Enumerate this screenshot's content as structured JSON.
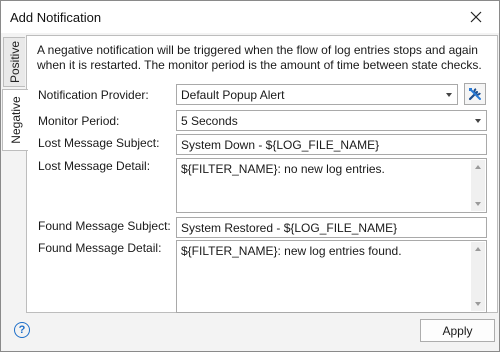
{
  "window": {
    "title": "Add Notification"
  },
  "tabs": [
    {
      "label": "Positive",
      "active": false
    },
    {
      "label": "Negative",
      "active": true
    }
  ],
  "description": "A negative notification will be triggered when the flow of log entries stops and again when it is restarted.  The monitor period is the amount of time between state checks.",
  "form": {
    "provider": {
      "label": "Notification Provider:",
      "value": "Default Popup Alert"
    },
    "monitor_period": {
      "label": "Monitor Period:",
      "value": "5 Seconds"
    },
    "lost_subject": {
      "label": "Lost Message Subject:",
      "value": "System Down - ${LOG_FILE_NAME}"
    },
    "lost_detail": {
      "label": "Lost Message Detail:",
      "value": "${FILTER_NAME}: no new log entries."
    },
    "found_subject": {
      "label": "Found Message Subject:",
      "value": "System Restored - ${LOG_FILE_NAME}"
    },
    "found_detail": {
      "label": "Found Message Detail:",
      "value": "${FILTER_NAME}: new log entries found."
    }
  },
  "buttons": {
    "apply": "Apply",
    "help": "?"
  },
  "icons": {
    "close": "close-icon",
    "tool": "tools-icon",
    "help": "help-icon"
  },
  "colors": {
    "accent": "#1e6fc9",
    "panel": "#ffffff",
    "chrome": "#f3f3f3"
  }
}
